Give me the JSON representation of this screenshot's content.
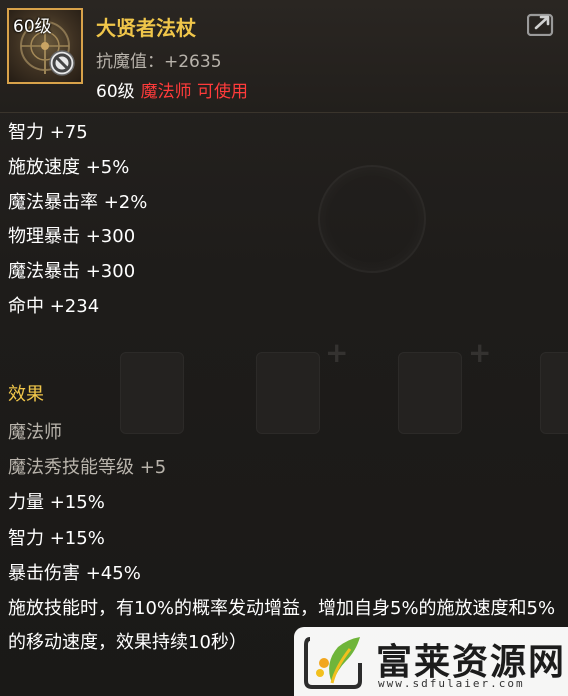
{
  "item": {
    "level_tag": "60级",
    "title": "大贤者法杖",
    "resist": "抗魔值：+2635",
    "req_level": "60级",
    "req_class": "魔法师 可使用",
    "icon": "staff-icon",
    "restriction_icon": "forbidden-icon",
    "share_icon": "share-icon"
  },
  "stats": [
    "智力 +75",
    "施放速度 +5%",
    "魔法暴击率 +2%",
    "物理暴击 +300",
    "魔法暴击 +300",
    "命中 +234"
  ],
  "effect": {
    "title": "效果",
    "lines_grey": [
      "魔法师",
      "魔法秀技能等级 +5"
    ],
    "lines_white": [
      "力量 +15%",
      "智力 +15%",
      "暴击伤害 +45%"
    ],
    "description": "施放技能时，有10%的概率发动增益，增加自身5%的施放速度和5%的移动速度，效果持续10秒）"
  },
  "watermark": {
    "name": "富莱资源网",
    "url": "www.sdfulaier.com"
  },
  "colors": {
    "title_gold": "#f0c64a",
    "class_red": "#ff3b3b",
    "border_gold": "#d8a24a"
  }
}
